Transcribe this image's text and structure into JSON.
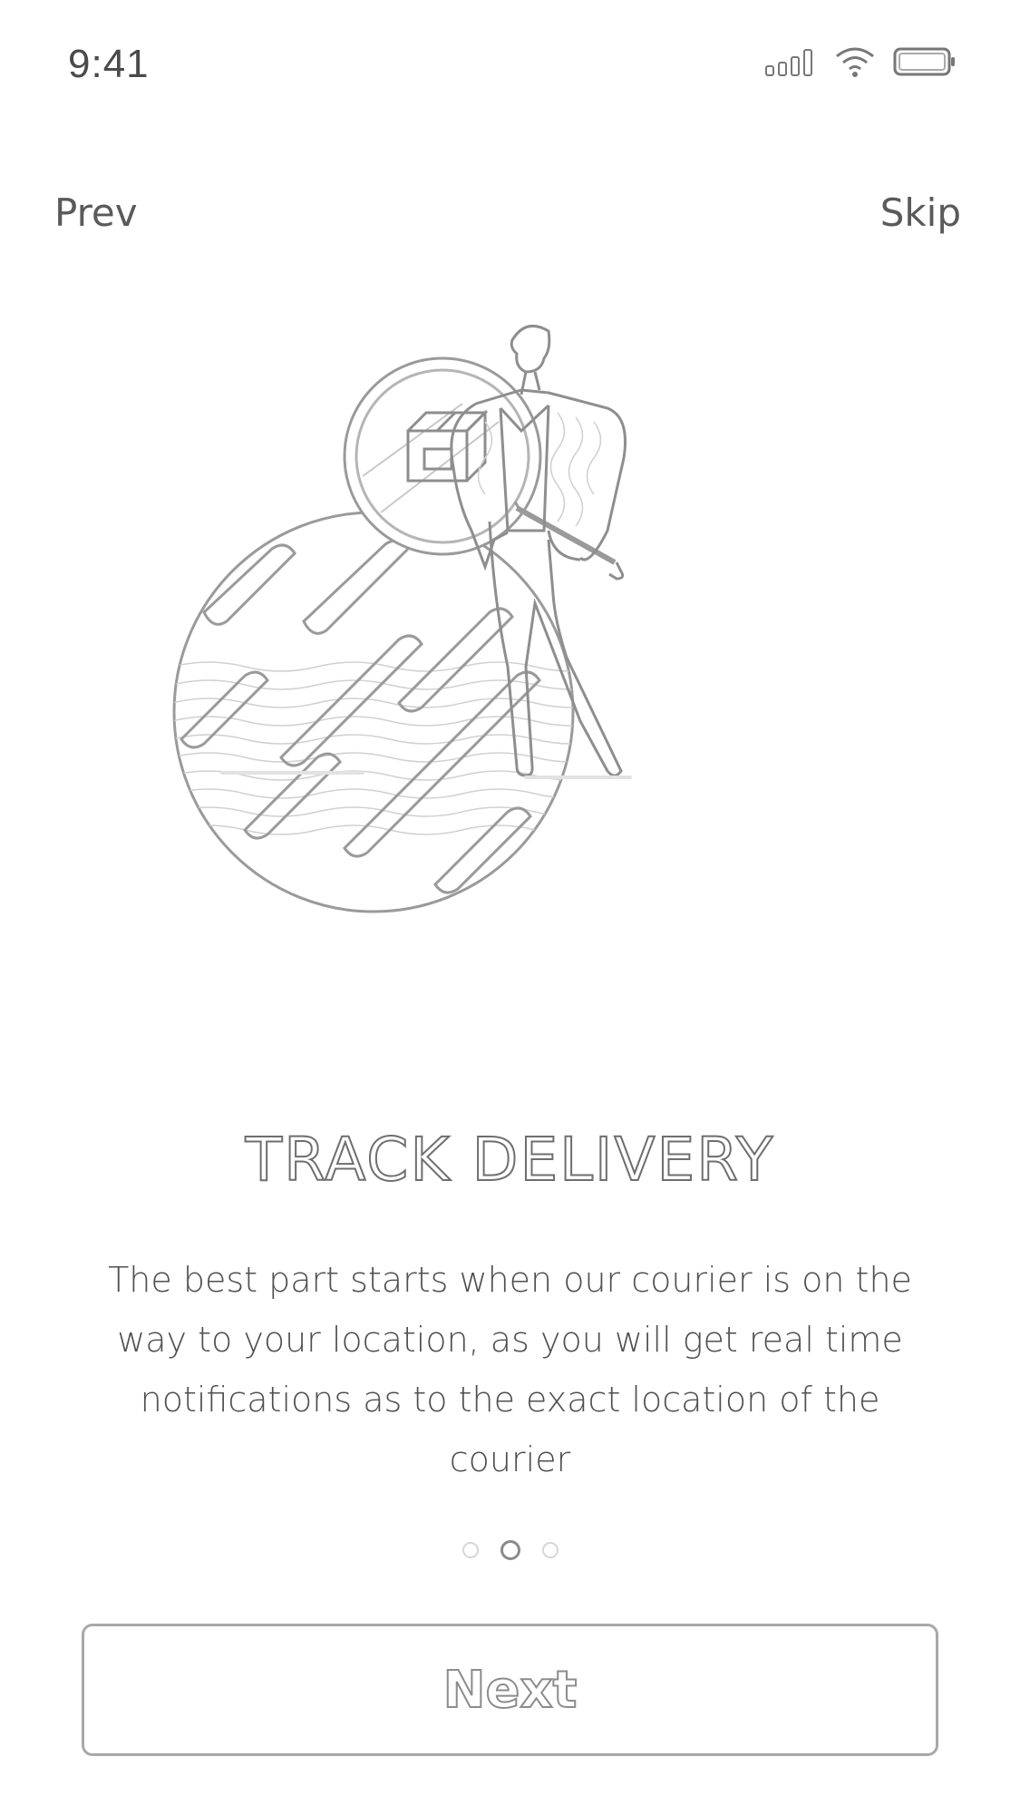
{
  "status_bar": {
    "time": "9:41",
    "icons": [
      "signal-icon",
      "wifi-icon",
      "battery-icon"
    ]
  },
  "nav": {
    "prev_label": "Prev",
    "skip_label": "Skip"
  },
  "illustration": {
    "icon": "courier-tracking-illustration"
  },
  "onboarding": {
    "title": "TRACK DELIVERY",
    "description": "The best part starts when our courier is on the way to your location, as you will get real time notifications as to the exact location of the courier",
    "pager": {
      "total_pages": 3,
      "current_page": 2
    }
  },
  "actions": {
    "next_label": "Next"
  },
  "colors": {
    "background": "#ffffff",
    "stroke": "#8c8c8c",
    "text": "#4f4f4f"
  }
}
